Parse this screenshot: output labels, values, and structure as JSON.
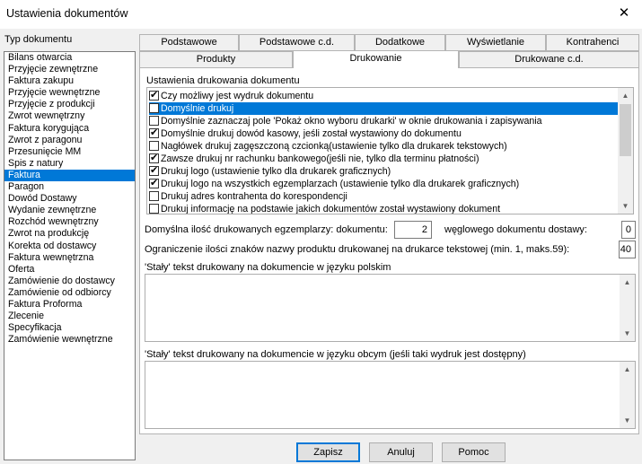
{
  "window": {
    "title": "Ustawienia dokumentów",
    "close_glyph": "✕"
  },
  "sidebar": {
    "label": "Typ dokumentu",
    "items": [
      "Bilans otwarcia",
      "Przyjęcie zewnętrzne",
      "Faktura zakupu",
      "Przyjęcie wewnętrzne",
      "Przyjęcie z produkcji",
      "Zwrot wewnętrzny",
      "Faktura korygująca",
      "Zwrot z paragonu",
      "Przesunięcie MM",
      "Spis z natury",
      "Faktura",
      "Paragon",
      "Dowód Dostawy",
      "Wydanie zewnętrzne",
      "Rozchód wewnętrzny",
      "Zwrot na produkcję",
      "Korekta od dostawcy",
      "Faktura wewnętrzna",
      "Oferta",
      "Zamówienie do dostawcy",
      "Zamówienie od odbiorcy",
      "Faktura Proforma",
      "Zlecenie",
      "Specyfikacja",
      "Zamówienie wewnętrzne"
    ],
    "selected_index": 10
  },
  "tabs": {
    "row1": [
      "Podstawowe",
      "Podstawowe c.d.",
      "Dodatkowe",
      "Wyświetlanie",
      "Kontrahenci"
    ],
    "row2": [
      "Produkty",
      "Drukowanie",
      "Drukowane c.d."
    ],
    "active": "Drukowanie"
  },
  "print_settings": {
    "group_label": "Ustawienia drukowania dokumentu",
    "options": [
      {
        "label": "Czy możliwy jest wydruk dokumentu",
        "checked": true,
        "selected": false
      },
      {
        "label": "Domyślnie drukuj",
        "checked": false,
        "selected": true
      },
      {
        "label": "Domyślnie zaznaczaj pole 'Pokaż okno wyboru drukarki' w oknie drukowania i zapisywania",
        "checked": false,
        "selected": false
      },
      {
        "label": "Domyślnie drukuj dowód kasowy, jeśli został wystawiony do dokumentu",
        "checked": true,
        "selected": false
      },
      {
        "label": "Nagłówek drukuj zagęszczoną czcionką(ustawienie tylko dla drukarek tekstowych)",
        "checked": false,
        "selected": false
      },
      {
        "label": "Zawsze drukuj nr rachunku bankowego(jeśli nie, tylko dla terminu płatności)",
        "checked": true,
        "selected": false
      },
      {
        "label": "Drukuj logo (ustawienie tylko dla drukarek graficznych)",
        "checked": true,
        "selected": false
      },
      {
        "label": "Drukuj logo na wszystkich egzemplarzach (ustawienie tylko dla drukarek graficznych)",
        "checked": true,
        "selected": false
      },
      {
        "label": "Drukuj adres kontrahenta do korespondencji",
        "checked": false,
        "selected": false
      },
      {
        "label": "Drukuj informację na podstawie jakich dokumentów został wystawiony dokument",
        "checked": false,
        "selected": false
      }
    ],
    "scroll_up": "▲",
    "scroll_down": "▼"
  },
  "copies": {
    "label_doc": "Domyślna ilość drukowanych egzemplarzy: dokumentu:",
    "doc_value": "2",
    "label_receipt": "węglowego dokumentu dostawy:",
    "receipt_value": "0"
  },
  "name_limit": {
    "label": "Ograniczenie ilości znaków nazwy produktu drukowanej na drukarce tekstowej (min. 1, maks.59):",
    "value": "40"
  },
  "fixed_text_pl": {
    "label": "'Stały' tekst drukowany na dokumencie w języku polskim",
    "value": ""
  },
  "fixed_text_foreign": {
    "label": "'Stały' tekst drukowany na dokumencie w języku obcym (jeśli taki wydruk jest dostępny)",
    "value": ""
  },
  "buttons": {
    "save": "Zapisz",
    "cancel": "Anuluj",
    "help": "Pomoc"
  }
}
